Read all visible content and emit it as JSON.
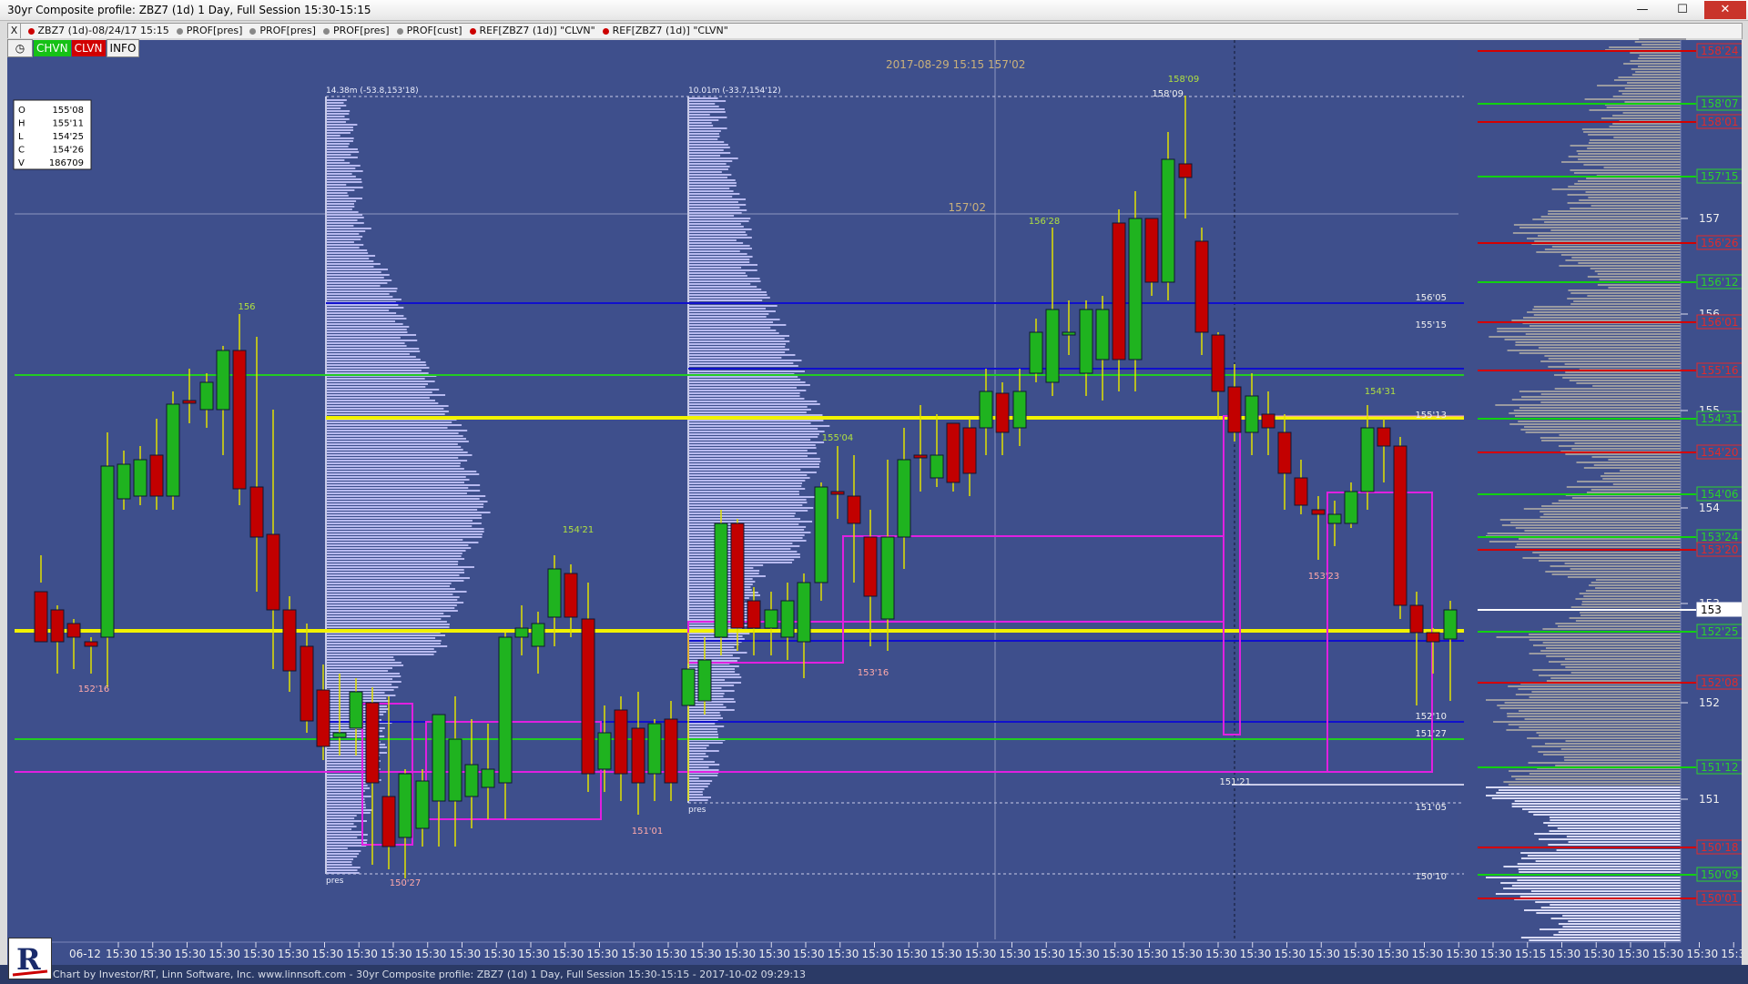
{
  "window": {
    "title": "30yr Composite profile: ZBZ7 (1d) 1 Day, Full Session 15:30-15:15",
    "minimize": "—",
    "maximize": "☐",
    "close": "✕"
  },
  "series_bar": {
    "close": "X",
    "items": [
      {
        "label": "ZBZ7 (1d)-08/24/17 15:15",
        "dot_color": "#cc0000"
      },
      {
        "label": "PROF[pres]",
        "dot_color": "#888888"
      },
      {
        "label": "PROF[pres]",
        "dot_color": "#888888"
      },
      {
        "label": "PROF[pres]",
        "dot_color": "#888888"
      },
      {
        "label": "PROF[cust]",
        "dot_color": "#888888"
      },
      {
        "label": "REF[ZBZ7 (1d)] \"CLVN\"",
        "dot_color": "#cc0000"
      },
      {
        "label": "REF[ZBZ7 (1d)] \"CLVN\"",
        "dot_color": "#cc0000"
      }
    ]
  },
  "indicators": {
    "clock": "◷",
    "chvn": "CHVN",
    "clvn": "CLVN",
    "info": "INFO"
  },
  "ohlcv": [
    {
      "key": "O",
      "value": "155'08"
    },
    {
      "key": "H",
      "value": "155'11"
    },
    {
      "key": "L",
      "value": "154'25"
    },
    {
      "key": "C",
      "value": "154'26"
    },
    {
      "key": "V",
      "value": "186709"
    }
  ],
  "cursor": {
    "datetime": "2017-08-29 15:15",
    "price": "157'02",
    "price_label": "157'02"
  },
  "profiles": [
    {
      "header": "14.38m (-53.8,153'18)",
      "footer": "pres"
    },
    {
      "header": "10.01m (-33.7,154'12)",
      "footer": "pres"
    }
  ],
  "price_labels": [
    "158'09",
    "158'09",
    "156'28",
    "156",
    "156'05",
    "155'15",
    "155'13",
    "154'31",
    "155'04",
    "154'21",
    "153'23",
    "153'16",
    "152'16",
    "152'10",
    "151'27",
    "151'21",
    "151'05",
    "151'01",
    "150'27",
    "150'10",
    "150'10"
  ],
  "axis": {
    "ticks": [
      "157",
      "156",
      "155",
      "154",
      "153",
      "152",
      "151"
    ],
    "tags": [
      {
        "label": "158'24",
        "kind": "red"
      },
      {
        "label": "158'07",
        "kind": "green"
      },
      {
        "label": "158'01",
        "kind": "red"
      },
      {
        "label": "157'15",
        "kind": "green"
      },
      {
        "label": "156'26",
        "kind": "red"
      },
      {
        "label": "156'12",
        "kind": "green"
      },
      {
        "label": "156'01",
        "kind": "red"
      },
      {
        "label": "155'16",
        "kind": "red"
      },
      {
        "label": "154'31",
        "kind": "green"
      },
      {
        "label": "154'20",
        "kind": "red"
      },
      {
        "label": "154'06",
        "kind": "green"
      },
      {
        "label": "153'24",
        "kind": "green"
      },
      {
        "label": "153'20",
        "kind": "red"
      },
      {
        "label": "153",
        "kind": "white"
      },
      {
        "label": "152'25",
        "kind": "green"
      },
      {
        "label": "152'08",
        "kind": "red"
      },
      {
        "label": "151'12",
        "kind": "green"
      },
      {
        "label": "150'18",
        "kind": "red"
      },
      {
        "label": "150'09",
        "kind": "green"
      },
      {
        "label": "150'01",
        "kind": "red"
      }
    ]
  },
  "x_axis": {
    "first": "06-12",
    "labels": [
      "15:30",
      "15:30",
      "15:30",
      "15:30",
      "15:30",
      "15:30",
      "15:30",
      "15:30",
      "15:30",
      "15:30",
      "15:30",
      "15:30",
      "15:30",
      "15:30",
      "15:30",
      "15:30",
      "15:30",
      "15:30",
      "15:30",
      "15:30",
      "15:30",
      "15:30",
      "15:30",
      "15:30",
      "15:30",
      "15:30",
      "15:30",
      "15:30",
      "15:30",
      "15:30",
      "15:30",
      "15:30",
      "15:30",
      "15:30",
      "15:30",
      "15:30",
      "15:30",
      "15:30",
      "15:30",
      "15:30",
      "15:30",
      "15:15",
      "15:30",
      "15:30",
      "15:30",
      "15:30",
      "15:30",
      "15:30",
      "15:30"
    ]
  },
  "status": "Chart by Investor/RT, Linn Software, Inc. www.linnsoft.com - 30yr Composite profile: ZBZ7 (1d) 1 Day, Full Session 15:30-15:15 - 2017-10-02 09:29:13",
  "colors": {
    "background": "#3e4f8c",
    "up": "#1fb31f",
    "down": "#c20000",
    "profile": "#b7b9ef",
    "yellow_line": "#f2f200",
    "green_line": "#22cc22",
    "blue_line": "#1010cc",
    "magenta_line": "#e020e0"
  }
}
